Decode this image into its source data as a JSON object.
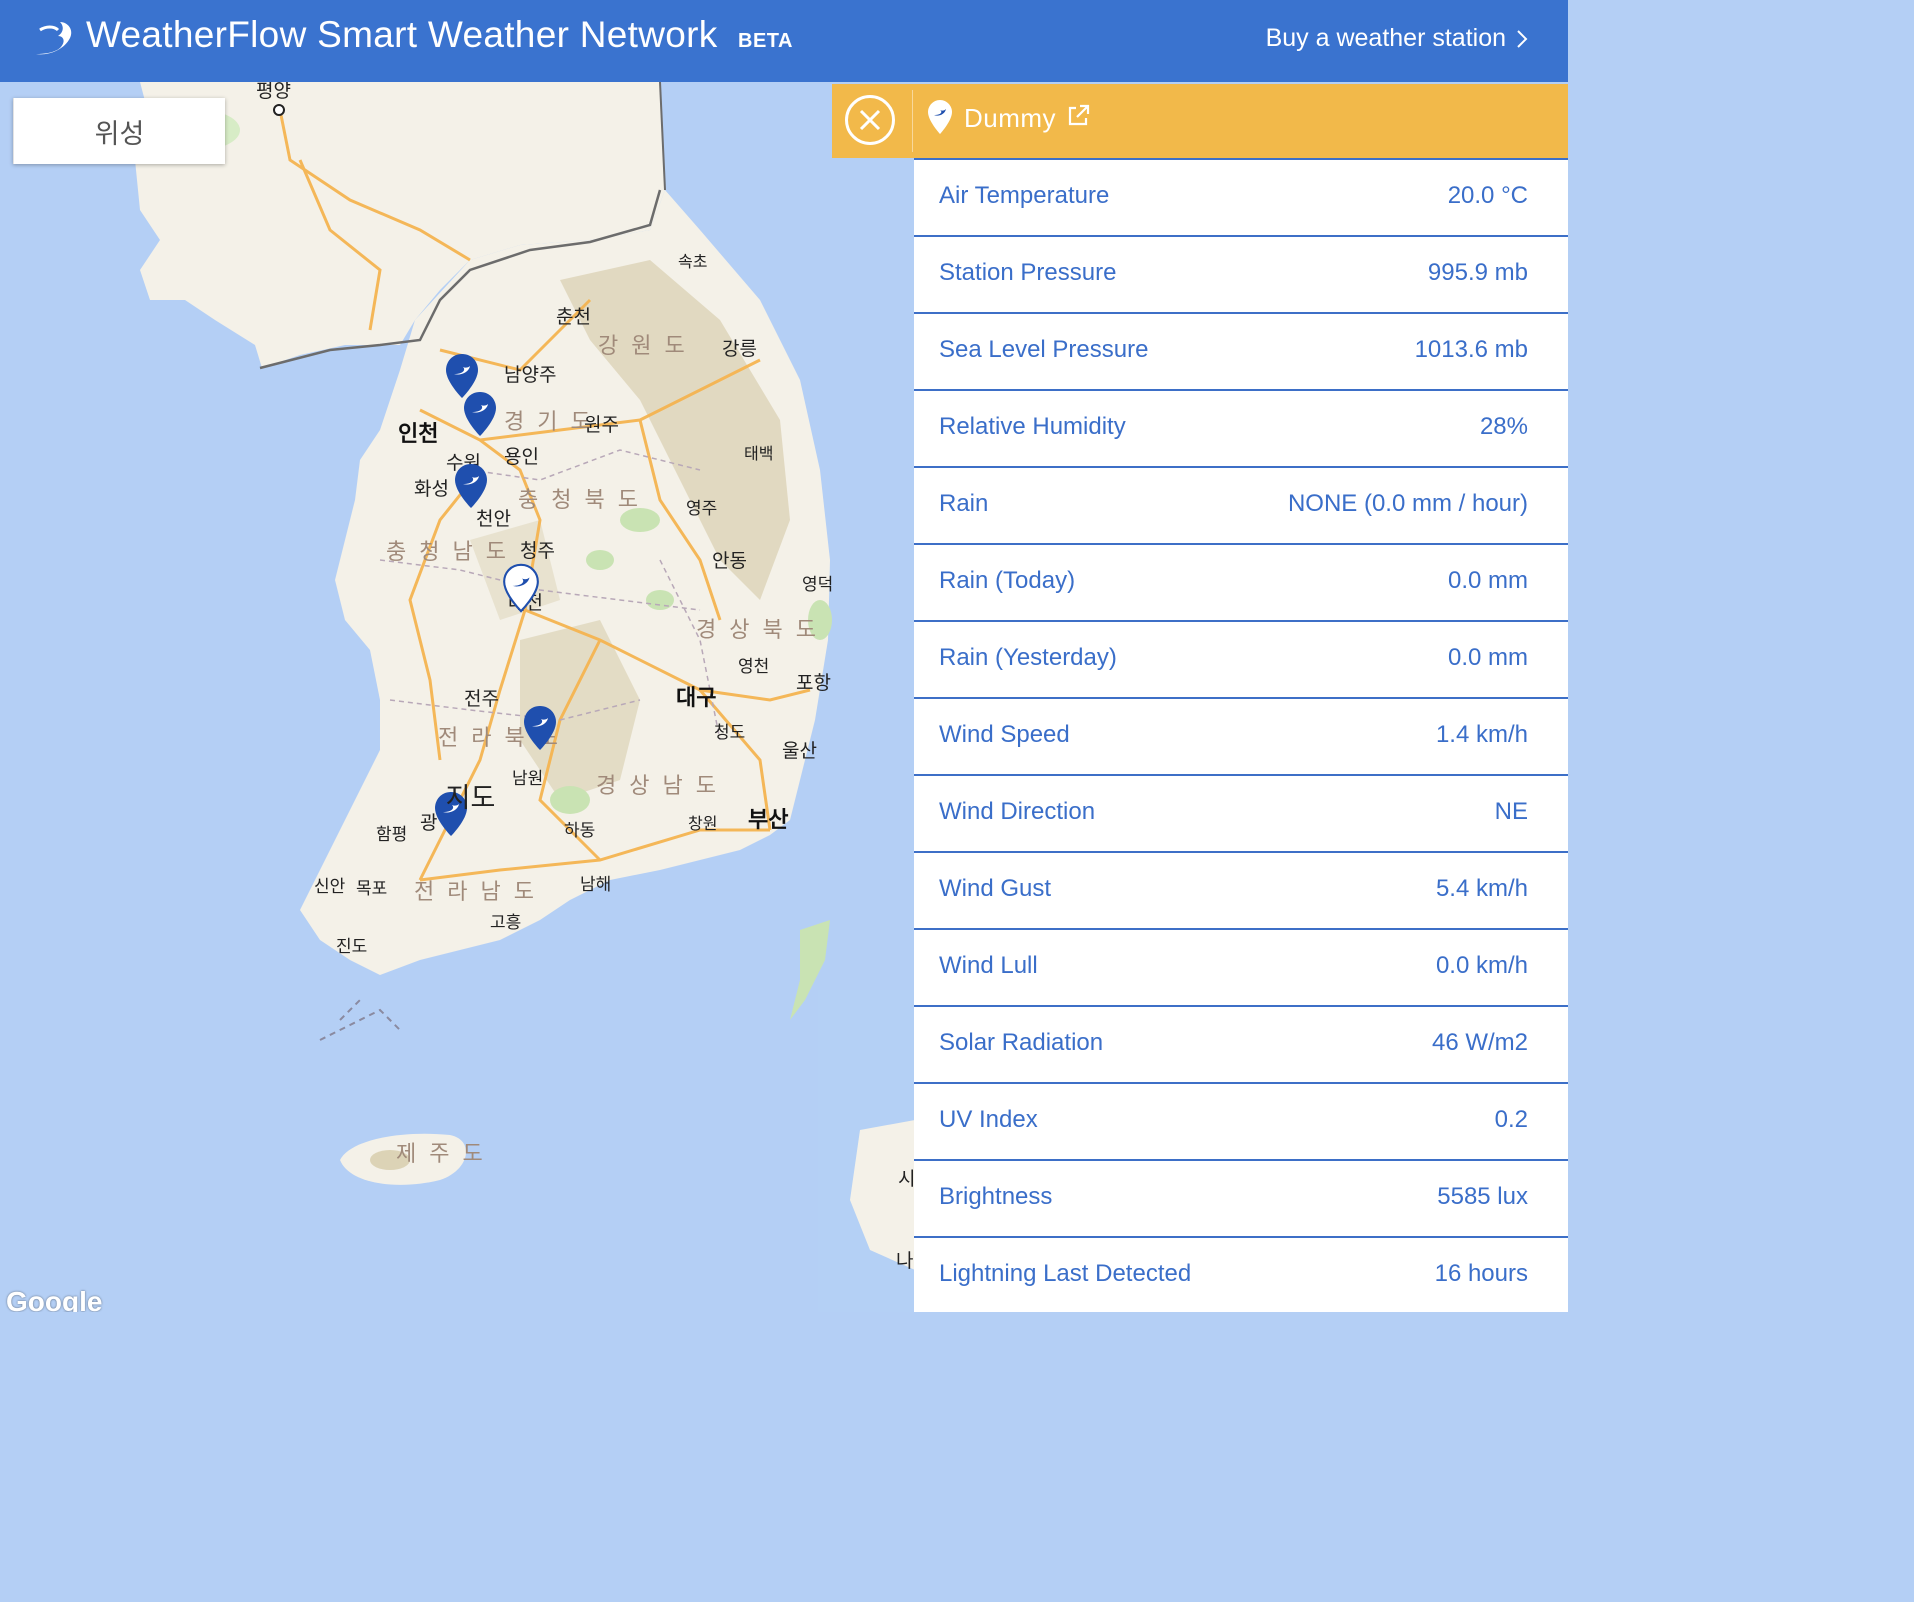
{
  "header": {
    "title": "WeatherFlow Smart Weather Network",
    "badge": "BETA",
    "buy_link": "Buy a weather station"
  },
  "map": {
    "toggle": {
      "map_label": "지도",
      "satellite_label": "위성"
    },
    "provider": "Google",
    "labels": {
      "pyongyang": "평양",
      "sokcho": "속초",
      "chuncheon": "춘천",
      "gangwon": "강 원 도",
      "gangneung": "강릉",
      "namyangju": "남양주",
      "incheon": "인천",
      "gyeonggi": "경 기 도",
      "wonju": "원주",
      "suwon": "수원",
      "yongin": "용인",
      "taebaek": "태백",
      "hwaseong": "화성",
      "chungbuk": "충 청 북 도",
      "cheonan": "천안",
      "yeongju": "영주",
      "chungnam": "충 청 남 도",
      "cheongju": "청주",
      "andong": "안동",
      "yeongdeok": "영덕",
      "gyeongbuk": "경 상 북 도",
      "yeongcheon": "영천",
      "pohang": "포항",
      "jeonju": "전주",
      "daegu": "대구",
      "jeonbuk": "전 라 북 도",
      "cheongdo": "청도",
      "ulsan": "울산",
      "namwon": "남원",
      "gyeongnam": "경 상 남 도",
      "busan": "부산",
      "hampyeong": "함평",
      "gwangju": "광",
      "hadong": "하동",
      "changwon": "창원",
      "sinan": "신안",
      "mokpo": "목포",
      "jeonnam": "전 라 남 도",
      "namhae": "남해",
      "goheung": "고흥",
      "jindo": "진도",
      "jeju": "제 주 도",
      "daejeon": "대전",
      "edge_si": "시",
      "edge_na": "나"
    }
  },
  "station": {
    "name": "Dummy"
  },
  "observations": [
    {
      "label": "Air Temperature",
      "value": "20.0 °C"
    },
    {
      "label": "Station Pressure",
      "value": "995.9 mb"
    },
    {
      "label": "Sea Level Pressure",
      "value": "1013.6 mb"
    },
    {
      "label": "Relative Humidity",
      "value": "28%"
    },
    {
      "label": "Rain",
      "value": "NONE (0.0 mm / hour)"
    },
    {
      "label": "Rain (Today)",
      "value": "0.0 mm"
    },
    {
      "label": "Rain (Yesterday)",
      "value": "0.0 mm"
    },
    {
      "label": "Wind Speed",
      "value": "1.4 km/h"
    },
    {
      "label": "Wind Direction",
      "value": "NE"
    },
    {
      "label": "Wind Gust",
      "value": "5.4 km/h"
    },
    {
      "label": "Wind Lull",
      "value": "0.0 km/h"
    },
    {
      "label": "Solar Radiation",
      "value": "46 W/m2"
    },
    {
      "label": "UV Index",
      "value": "0.2"
    },
    {
      "label": "Brightness",
      "value": "5585 lux"
    },
    {
      "label": "Lightning Last Detected",
      "value": "16 hours"
    }
  ],
  "colors": {
    "header": "#3a73cf",
    "station_bar": "#f2b94a",
    "text_blue": "#3a6ec9",
    "sea": "#b4cff5",
    "land": "#f4f1e8"
  }
}
